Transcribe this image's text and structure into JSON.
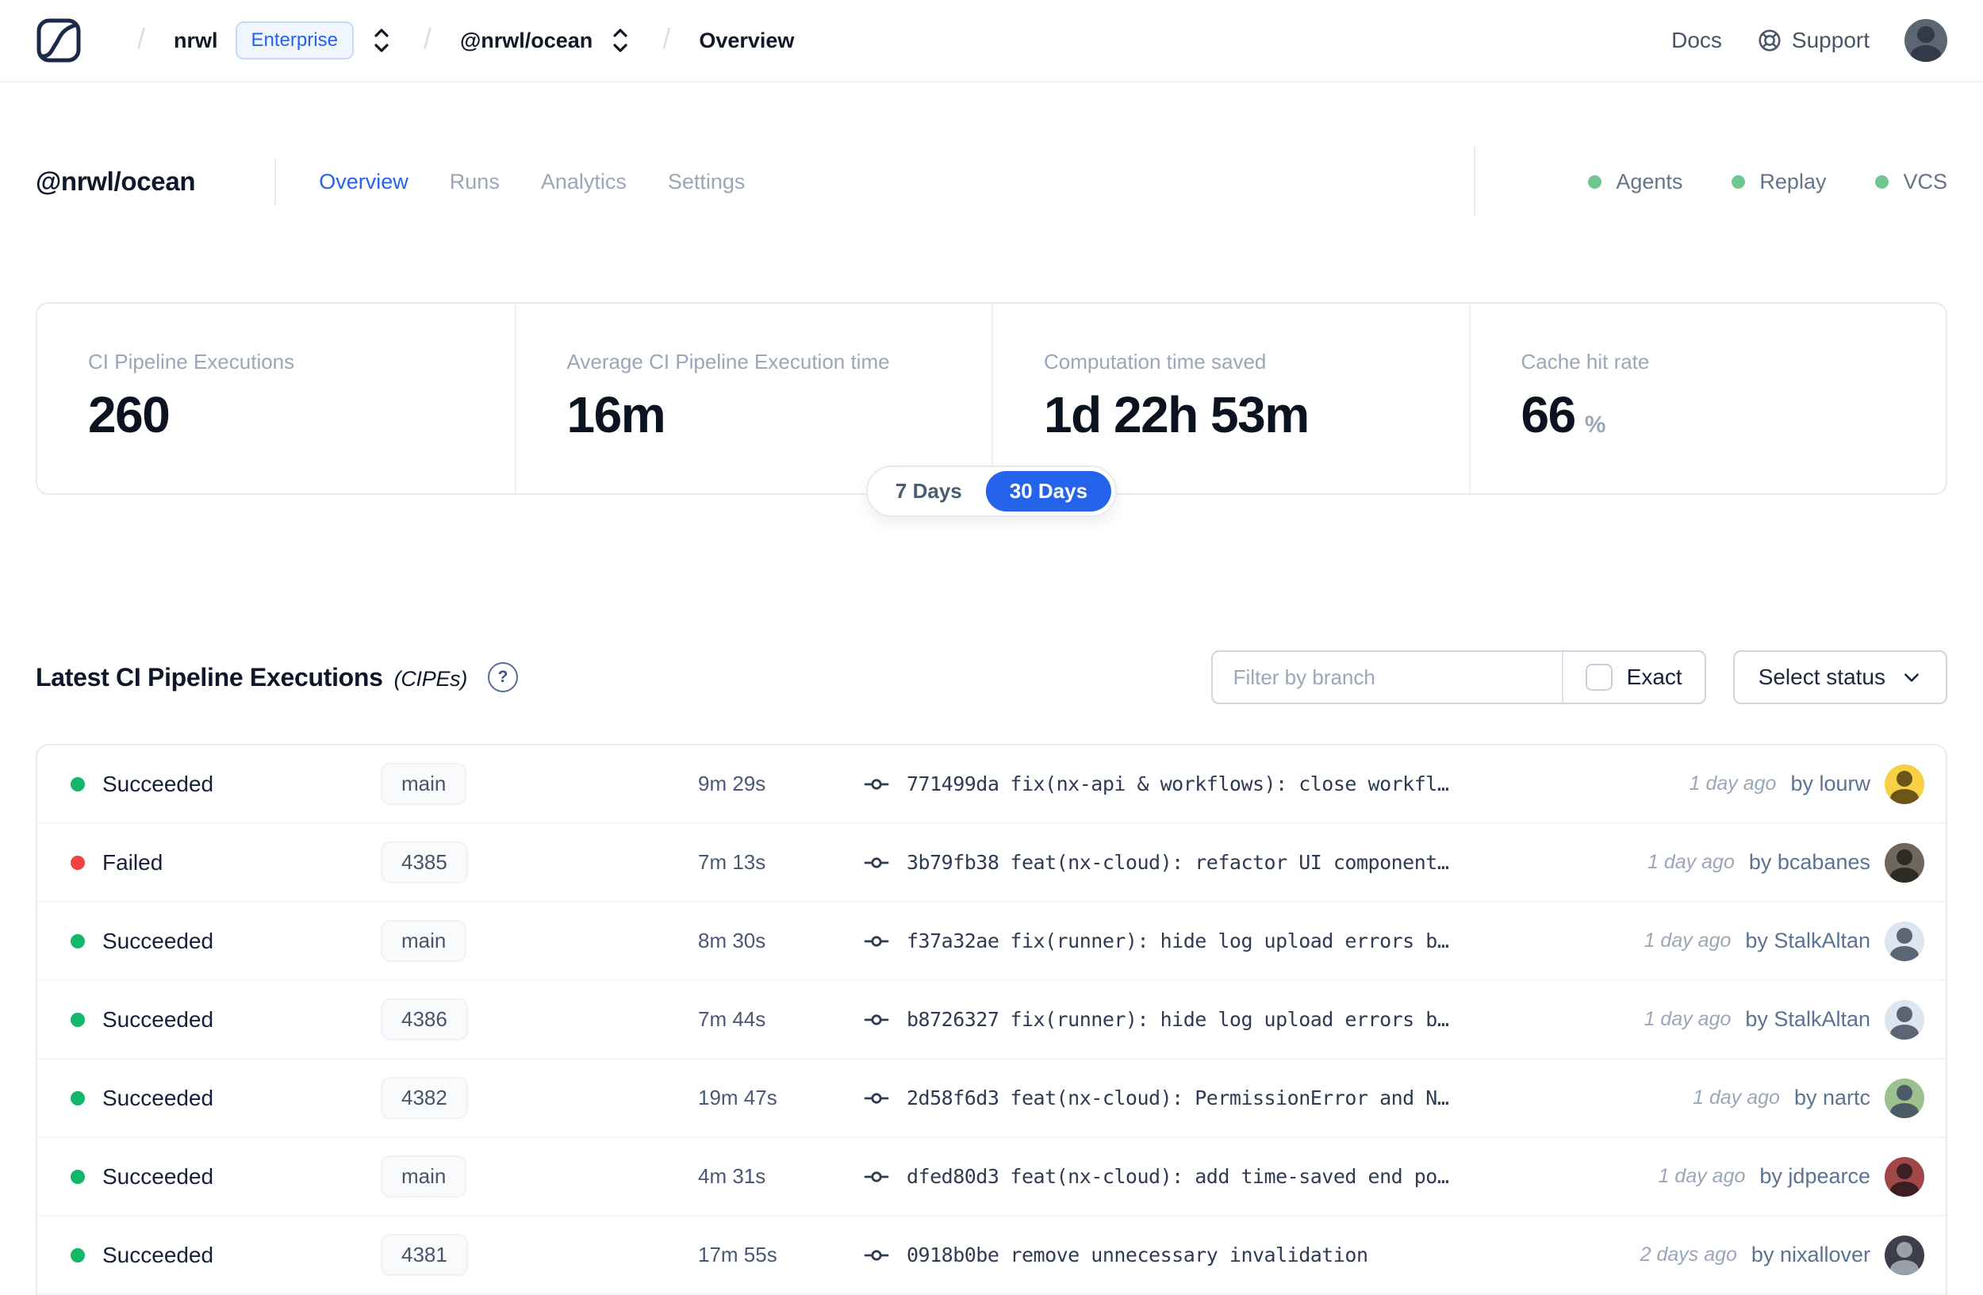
{
  "nav": {
    "separator": "/",
    "org": "nrwl",
    "org_badge": "Enterprise",
    "workspace": "@nrwl/ocean",
    "current_page": "Overview",
    "docs_label": "Docs",
    "support_label": "Support",
    "user_avatar_style": "background:#5c6672;color:#313a46"
  },
  "header": {
    "title": "@nrwl/ocean",
    "tabs": [
      {
        "label": "Overview"
      },
      {
        "label": "Runs"
      },
      {
        "label": "Analytics"
      },
      {
        "label": "Settings"
      }
    ],
    "active_tab": "Overview",
    "services": [
      {
        "label": "Agents",
        "dot_style": "background:#6fc690"
      },
      {
        "label": "Replay",
        "dot_style": "background:#6fc690"
      },
      {
        "label": "VCS",
        "dot_style": "background:#6fc690"
      }
    ]
  },
  "stats": {
    "cards": [
      {
        "label": "CI Pipeline Executions",
        "value": "260"
      },
      {
        "label": "Average CI Pipeline Execution time",
        "value": "16m"
      },
      {
        "label": "Computation time saved",
        "value": "1d 22h 53m"
      },
      {
        "label": "Cache hit rate",
        "value": "66",
        "unit": "%"
      }
    ]
  },
  "range_toggle": {
    "options": [
      {
        "label": "7 Days"
      },
      {
        "label": "30 Days"
      }
    ],
    "selected": "30 Days",
    "selected_color": "#2563eb"
  },
  "cipe": {
    "title": "Latest CI Pipeline Executions",
    "subtitle": "(CIPEs)",
    "help_icon": "?",
    "filter_placeholder": "Filter by branch",
    "exact_label": "Exact",
    "status_button_label": "Select status"
  },
  "table": {
    "status_colors": {
      "succeeded": "#12b76a",
      "failed": "#f04444"
    },
    "rows": [
      {
        "status": "Succeeded",
        "dot_style": "background:#12b76a",
        "branch": "main",
        "duration": "9m 29s",
        "commit_hash": "771499da",
        "commit_message": "fix(nx-api & workflows): close workfl…",
        "time_ago": "1 day ago",
        "author": "by lourw",
        "avatar_style": "background:#f7d046;color:#6b5618"
      },
      {
        "status": "Failed",
        "dot_style": "background:#f04444",
        "branch": "4385",
        "duration": "7m 13s",
        "commit_hash": "3b79fb38",
        "commit_message": "feat(nx-cloud): refactor UI component…",
        "time_ago": "1 day ago",
        "author": "by bcabanes",
        "avatar_style": "background:#6f675e;color:#2e2a26"
      },
      {
        "status": "Succeeded",
        "dot_style": "background:#12b76a",
        "branch": "main",
        "duration": "8m 30s",
        "commit_hash": "f37a32ae",
        "commit_message": "fix(runner): hide log upload errors b…",
        "time_ago": "1 day ago",
        "author": "by StalkAltan",
        "avatar_style": "background:#dde6ee;color:#5a6675"
      },
      {
        "status": "Succeeded",
        "dot_style": "background:#12b76a",
        "branch": "4386",
        "duration": "7m 44s",
        "commit_hash": "b8726327",
        "commit_message": "fix(runner): hide log upload errors b…",
        "time_ago": "1 day ago",
        "author": "by StalkAltan",
        "avatar_style": "background:#dde6ee;color:#5a6675"
      },
      {
        "status": "Succeeded",
        "dot_style": "background:#12b76a",
        "branch": "4382",
        "duration": "19m 47s",
        "commit_hash": "2d58f6d3",
        "commit_message": "feat(nx-cloud): PermissionError and N…",
        "time_ago": "1 day ago",
        "author": "by nartc",
        "avatar_style": "background:#9dc08f;color:#4c5c66"
      },
      {
        "status": "Succeeded",
        "dot_style": "background:#12b76a",
        "branch": "main",
        "duration": "4m 31s",
        "commit_hash": "dfed80d3",
        "commit_message": "feat(nx-cloud): add time-saved end po…",
        "time_ago": "1 day ago",
        "author": "by jdpearce",
        "avatar_style": "background:#a04848;color:#3c1f23"
      },
      {
        "status": "Succeeded",
        "dot_style": "background:#12b76a",
        "branch": "4381",
        "duration": "17m 55s",
        "commit_hash": "0918b0be",
        "commit_message": "remove unnecessary invalidation",
        "time_ago": "2 days ago",
        "author": "by nixallover",
        "avatar_style": "background:#3c3f46;color:#9aa0ab"
      }
    ]
  }
}
